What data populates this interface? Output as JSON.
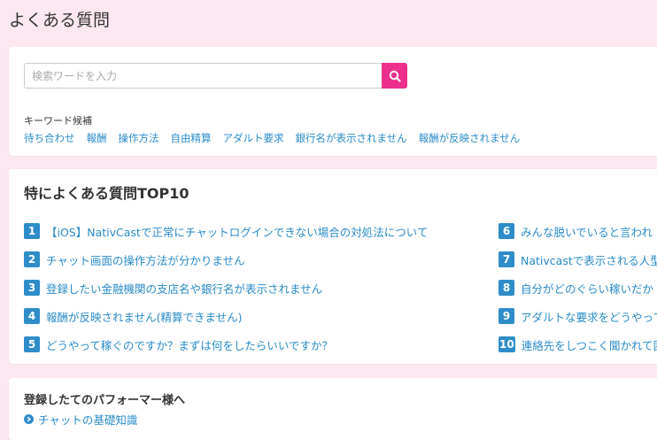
{
  "page": {
    "title": "よくある質問"
  },
  "search": {
    "placeholder": "検索ワードを入力",
    "button_icon": "search-icon",
    "keywords_label": "キーワード候補",
    "keywords": [
      "待ち合わせ",
      "報酬",
      "操作方法",
      "自由精算",
      "アダルト要求",
      "銀行名が表示されません",
      "報酬が反映されません"
    ]
  },
  "top10": {
    "title": "特によくある質問TOP10",
    "left": [
      {
        "num": "1",
        "text": "【iOS】NativCastで正常にチャットログインできない場合の対処法について"
      },
      {
        "num": "2",
        "text": "チャット画面の操作方法が分かりません"
      },
      {
        "num": "3",
        "text": "登録したい金融機関の支店名や銀行名が表示されません"
      },
      {
        "num": "4",
        "text": "報酬が反映されません(精算できません)"
      },
      {
        "num": "5",
        "text": "どうやって稼ぐのですか？まずは何をしたらいいですか？"
      }
    ],
    "right": [
      {
        "num": "6",
        "text": "みんな脱いでいると言われ"
      },
      {
        "num": "7",
        "text": "Nativcastで表示される人型"
      },
      {
        "num": "8",
        "text": "自分がどのぐらい稼いだか"
      },
      {
        "num": "9",
        "text": "アダルトな要求をどうやって"
      },
      {
        "num": "10",
        "text": "連絡先をしつこく聞かれて困"
      }
    ]
  },
  "guide": {
    "title": "登録したてのパフォーマー様へ",
    "link": "チャットの基礎知識"
  },
  "colors": {
    "accent": "#ec2f8d",
    "link": "#2a8bc9",
    "badge": "#2e8dc8",
    "background": "#fde8f1"
  }
}
